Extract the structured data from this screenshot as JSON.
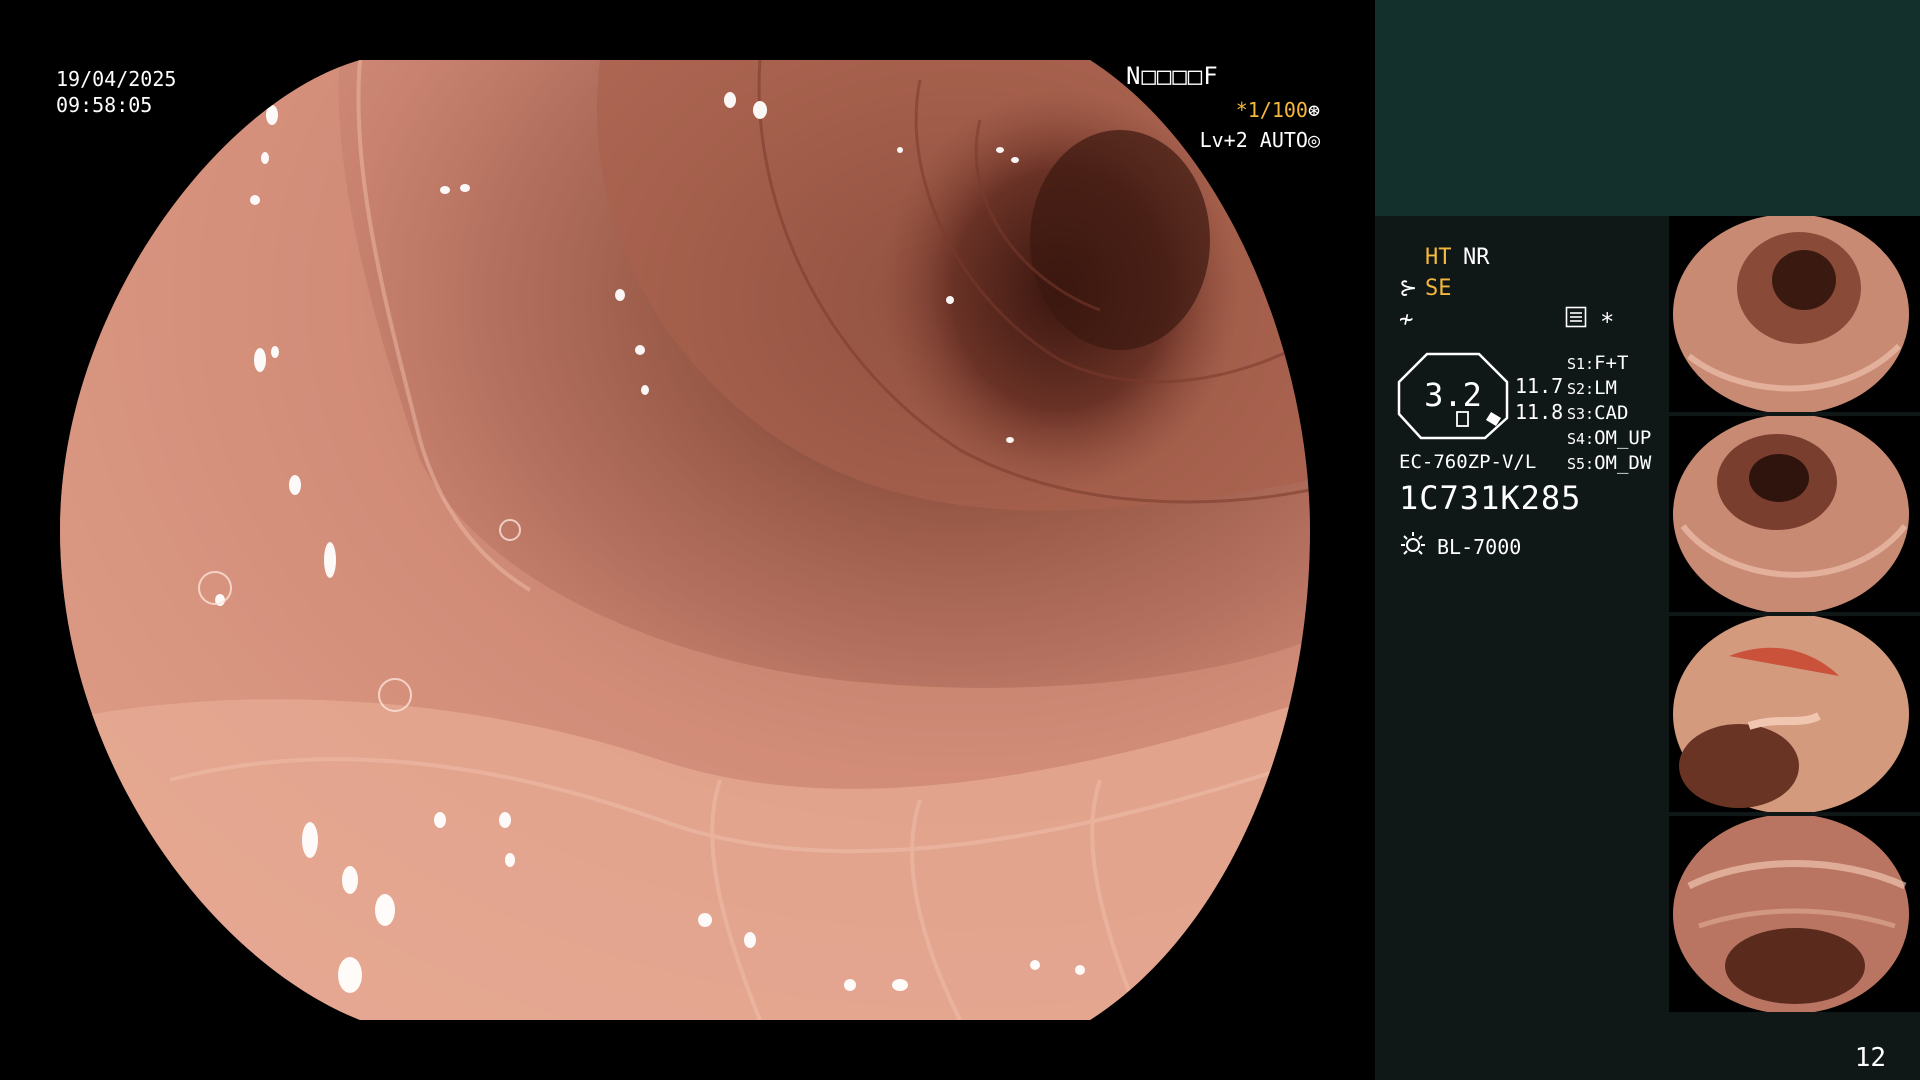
{
  "overlay": {
    "date": "19/04/2025",
    "time": "09:58:05",
    "patient_id": "N□□□□F",
    "shutter": "*1/100",
    "level": "Lv+2 AUTO"
  },
  "panel": {
    "ht": "HT",
    "nr": "NR",
    "se": "SE",
    "star": "*",
    "zoom": "3.2",
    "zoom_a": "11.7",
    "zoom_b": "11.8",
    "presets": [
      {
        "key": "S1:",
        "value": "F+T"
      },
      {
        "key": "S2:",
        "value": "LM"
      },
      {
        "key": "S3:",
        "value": "CAD"
      },
      {
        "key": "S4:",
        "value": "OM_UP"
      },
      {
        "key": "S5:",
        "value": "OM_DW"
      }
    ],
    "scope_model": "EC-760ZP-V/L",
    "scope_serial": "1C731K285",
    "light_source": "BL-7000",
    "page_number": "12"
  },
  "colors": {
    "accent": "#f5b83c",
    "panel_top": "#14302c",
    "panel": "#0f1817"
  },
  "icons": [
    "se-icon",
    "enhance-icon",
    "menu-icon",
    "light-source-icon",
    "shutter-icon",
    "auto-icon"
  ]
}
